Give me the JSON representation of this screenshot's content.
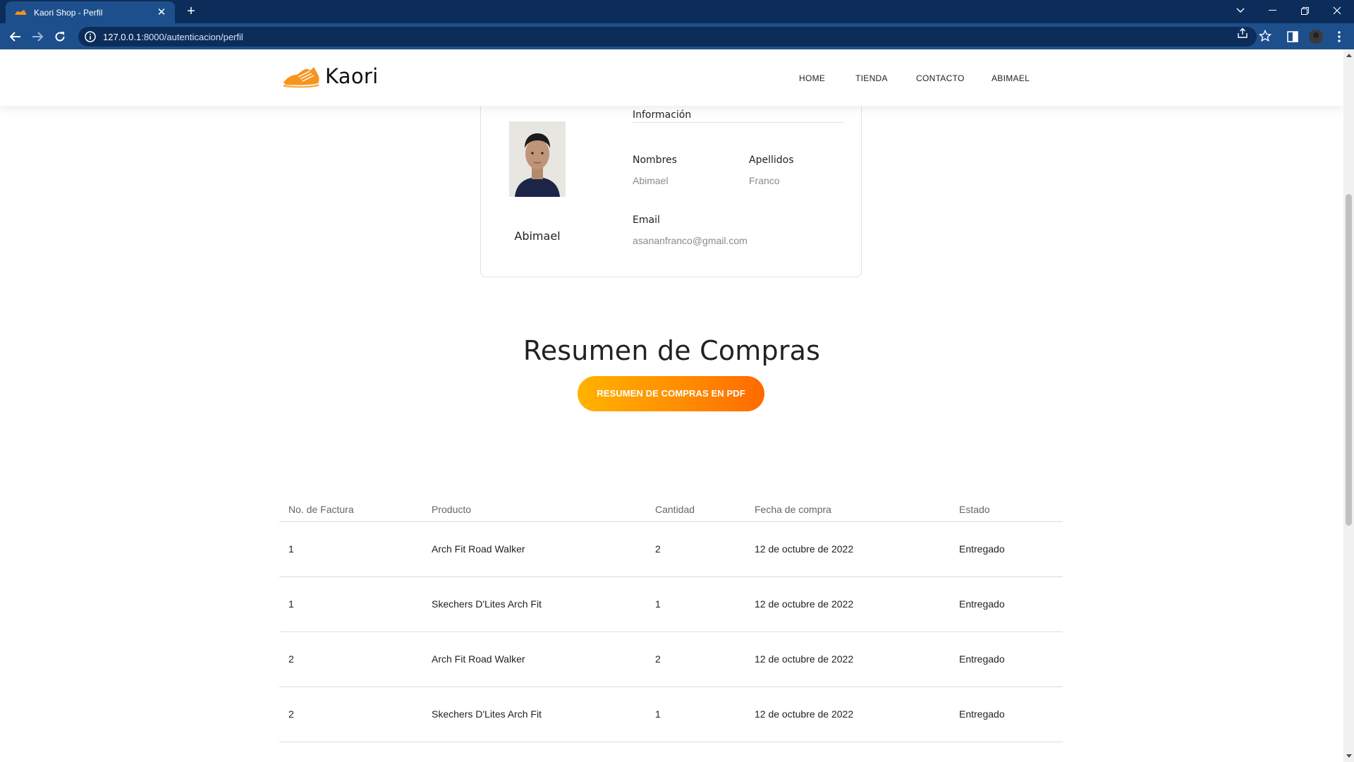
{
  "browser": {
    "tab_title": "Kaori Shop - Perfil",
    "url_host": "127.0.0.1",
    "url_rest": ":8000/autenticacion/perfil"
  },
  "site": {
    "brand": "Kaori",
    "nav": [
      "HOME",
      "TIENDA",
      "CONTACTO",
      "ABIMAEL"
    ],
    "accent": "#ff8a00"
  },
  "profile": {
    "name": "Abimael",
    "section_title": "Información",
    "nombres_label": "Nombres",
    "nombres_value": "Abimael",
    "apellidos_label": "Apellidos",
    "apellidos_value": "Franco",
    "email_label": "Email",
    "email_value": "asananfranco@gmail.com"
  },
  "summary": {
    "title": "Resumen de Compras",
    "pdf_button": "RESUMEN DE COMPRAS EN PDF"
  },
  "orders": {
    "headers": [
      "No. de Factura",
      "Producto",
      "Cantidad",
      "Fecha de compra",
      "Estado"
    ],
    "rows": [
      [
        "1",
        "Arch Fit Road Walker",
        "2",
        "12 de octubre de 2022",
        "Entregado"
      ],
      [
        "1",
        "Skechers D'Lites Arch Fit",
        "1",
        "12 de octubre de 2022",
        "Entregado"
      ],
      [
        "2",
        "Arch Fit Road Walker",
        "2",
        "12 de octubre de 2022",
        "Entregado"
      ],
      [
        "2",
        "Skechers D'Lites Arch Fit",
        "1",
        "12 de octubre de 2022",
        "Entregado"
      ]
    ]
  }
}
